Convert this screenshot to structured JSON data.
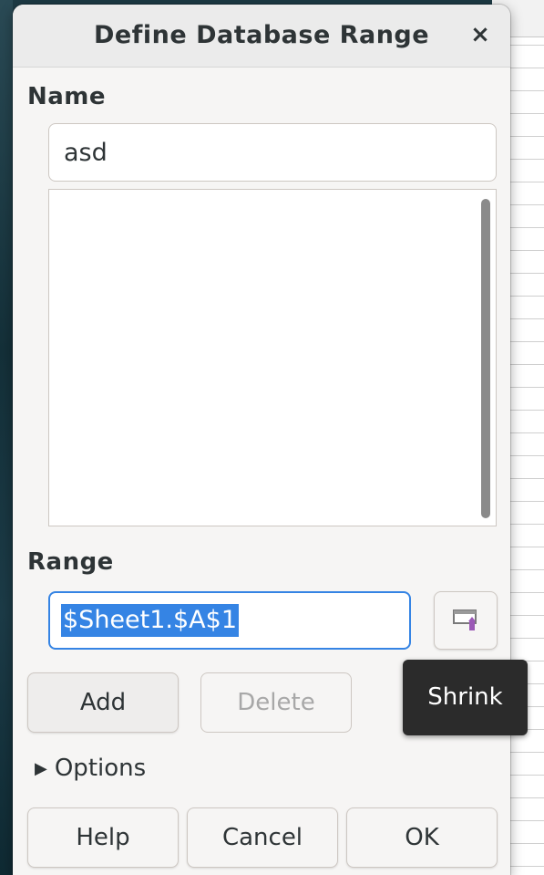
{
  "dialog": {
    "title": "Define Database Range",
    "close_symbol": "×"
  },
  "name_section": {
    "label": "Name",
    "value": "asd"
  },
  "range_section": {
    "label": "Range",
    "value": "$Sheet1.$A$1",
    "shrink_icon": "shrink-icon"
  },
  "buttons": {
    "add": "Add",
    "delete": "Delete",
    "help": "Help",
    "cancel": "Cancel",
    "ok": "OK"
  },
  "options": {
    "label": "Options",
    "arrow": "▶"
  },
  "tooltip": {
    "text": "Shrink"
  },
  "colors": {
    "accent": "#3584e4",
    "tooltip_bg": "#2b2b2b"
  }
}
